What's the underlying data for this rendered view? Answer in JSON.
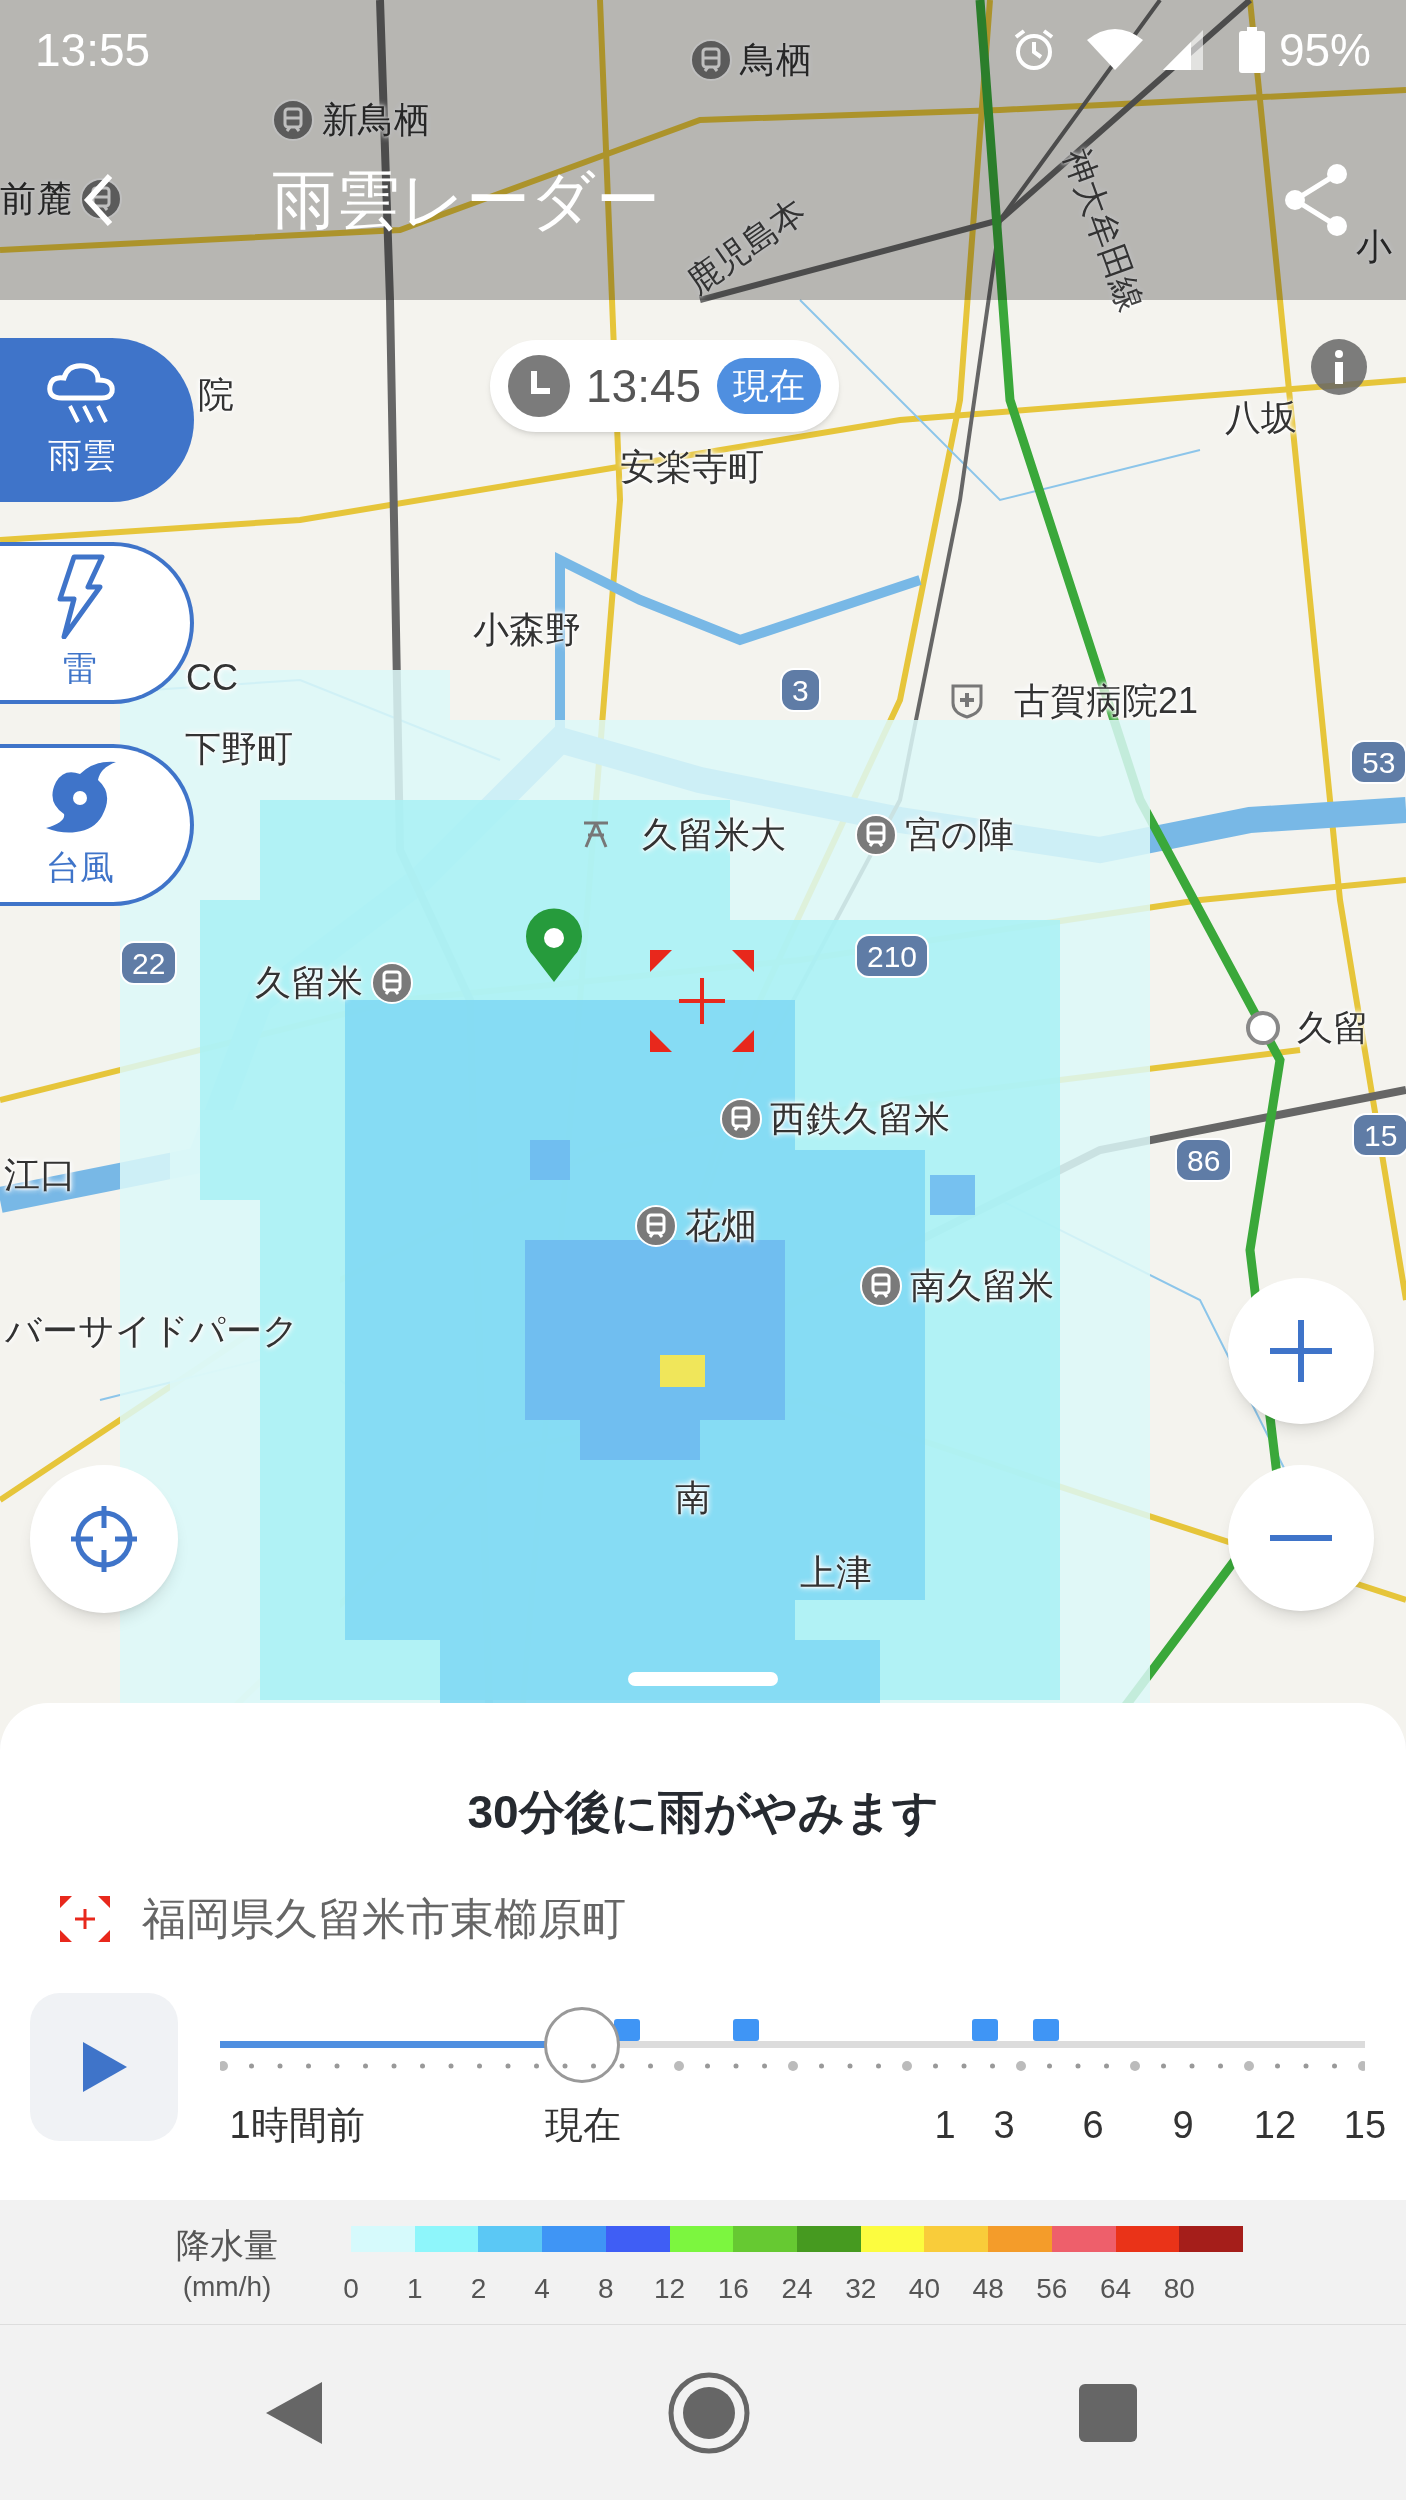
{
  "status_bar": {
    "time": "13:55",
    "battery": "95%"
  },
  "header": {
    "title": "雨雲レーダー"
  },
  "layer_buttons": [
    {
      "label": "雨雲",
      "kind": "rain",
      "selected": true
    },
    {
      "label": "雷",
      "kind": "thunder",
      "selected": false
    },
    {
      "label": "台風",
      "kind": "typhoon",
      "selected": false
    }
  ],
  "time_pill": {
    "time": "13:45",
    "badge": "現在"
  },
  "map_labels": [
    {
      "text": "鳥栖",
      "kind": "station"
    },
    {
      "text": "新鳥栖",
      "kind": "station"
    },
    {
      "text": "前麓",
      "kind": "station_right"
    },
    {
      "text": "鹿児島本",
      "kind": "line"
    },
    {
      "text": "神大牟田線",
      "kind": "line"
    },
    {
      "text": "小",
      "kind": "place"
    },
    {
      "text": "院",
      "kind": "place"
    },
    {
      "text": "安楽寺町",
      "kind": "place"
    },
    {
      "text": "八坂",
      "kind": "place"
    },
    {
      "text": "小森野",
      "kind": "place"
    },
    {
      "text": "3",
      "kind": "road"
    },
    {
      "text": "古賀病院21",
      "kind": "hospital"
    },
    {
      "text": "CC",
      "kind": "place"
    },
    {
      "text": "下野町",
      "kind": "place"
    },
    {
      "text": "53",
      "kind": "road"
    },
    {
      "text": "久留米大",
      "kind": "school"
    },
    {
      "text": "宮の陣",
      "kind": "station"
    },
    {
      "text": "22",
      "kind": "road"
    },
    {
      "text": "久留米",
      "kind": "station_right"
    },
    {
      "text": "210",
      "kind": "road"
    },
    {
      "text": "久留",
      "kind": "stop"
    },
    {
      "text": "西鉄久留米",
      "kind": "station"
    },
    {
      "text": "江口",
      "kind": "place"
    },
    {
      "text": "86",
      "kind": "road"
    },
    {
      "text": "15",
      "kind": "road"
    },
    {
      "text": "花畑",
      "kind": "station"
    },
    {
      "text": "南久留米",
      "kind": "station"
    },
    {
      "text": "バーサイドパーク",
      "kind": "place"
    },
    {
      "text": "南",
      "kind": "place"
    },
    {
      "text": "上津",
      "kind": "place"
    }
  ],
  "sheet": {
    "title": "30分後に雨がやみます",
    "location": "福岡県久留米市東櫛原町",
    "slider": {
      "level": 0.316,
      "labels": [
        "1時間前",
        "現在",
        "1",
        "3",
        "6",
        "9",
        "12",
        "15"
      ]
    }
  },
  "legend": {
    "title": "降水量",
    "unit": "(mm/h)",
    "items": [
      {
        "label": "0",
        "color": "#d6fafc"
      },
      {
        "label": "1",
        "color": "#8ef6fb"
      },
      {
        "label": "2",
        "color": "#5bc8f5"
      },
      {
        "label": "4",
        "color": "#3f95f5"
      },
      {
        "label": "8",
        "color": "#3f5ef5"
      },
      {
        "label": "12",
        "color": "#7cf63f"
      },
      {
        "label": "16",
        "color": "#66c932"
      },
      {
        "label": "24",
        "color": "#469a20"
      },
      {
        "label": "32",
        "color": "#fcfc3f"
      },
      {
        "label": "40",
        "color": "#f9cc3a"
      },
      {
        "label": "48",
        "color": "#f49c2a"
      },
      {
        "label": "56",
        "color": "#ee5f6b"
      },
      {
        "label": "64",
        "color": "#ea3318"
      },
      {
        "label": "80",
        "color": "#a51e1a"
      }
    ]
  }
}
